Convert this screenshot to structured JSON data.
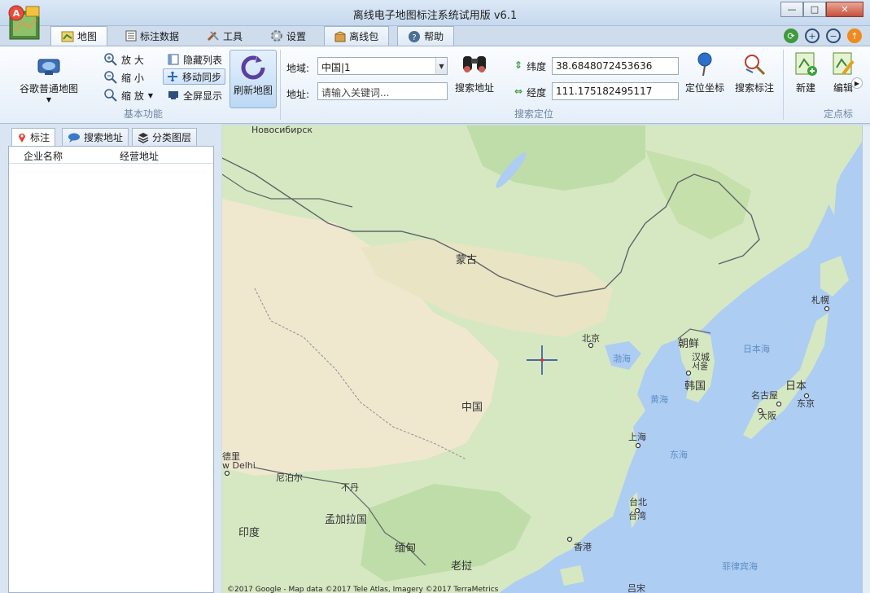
{
  "window": {
    "title": "离线电子地图标注系统试用版 v6.1",
    "logo_letter": "A",
    "controls": [
      "minimize-icon",
      "maximize-icon",
      "close-icon"
    ]
  },
  "tabs": [
    {
      "label": "地图",
      "icon": "map-icon",
      "active": true
    },
    {
      "label": "标注数据",
      "icon": "table-icon"
    },
    {
      "label": "工具",
      "icon": "tools-icon"
    },
    {
      "label": "设置",
      "icon": "gear-icon"
    },
    {
      "label": "离线包",
      "icon": "package-icon"
    },
    {
      "label": "帮助",
      "icon": "help-icon"
    }
  ],
  "right_tools": [
    "refresh-icon",
    "zoom-in-icon",
    "zoom-out-icon",
    "info-icon"
  ],
  "ribbon": {
    "basic": {
      "label": "基本功能",
      "map_type": "谷歌普通地图",
      "zoom_in": "放 大",
      "zoom_out": "缩 小",
      "zoom": "缩 放",
      "hide_list": "隐藏列表",
      "move_sync": "移动同步",
      "fullscreen": "全屏显示",
      "refresh": "刷新地图"
    },
    "search": {
      "label": "搜索定位",
      "region_label": "地域:",
      "region_value": "中国|1",
      "address_label": "地址:",
      "address_placeholder": "请输入关键词...",
      "search_address": "搜索地址",
      "lat_label": "纬度",
      "lat_value": "38.6848072453636",
      "lng_label": "经度",
      "lng_value": "111.175182495117",
      "locate": "定位坐标",
      "search_mark": "搜索标注"
    },
    "points": {
      "label": "定点标",
      "new": "新建",
      "edit": "编辑"
    }
  },
  "panel": {
    "tabs": [
      {
        "label": "标注",
        "icon": "pin-icon"
      },
      {
        "label": "搜索地址",
        "icon": "speech-bubble-icon"
      },
      {
        "label": "分类图层",
        "icon": "layers-icon"
      }
    ],
    "columns": [
      "企业名称",
      "经营地址"
    ]
  },
  "map": {
    "labels": {
      "novosibirsk": "Новосибирск",
      "mongolia": "蒙古",
      "beijing": "北京",
      "bohai": "渤海",
      "north_korea": "朝鲜",
      "seoul": "汉城",
      "seoul2": "서울",
      "korea": "韩国",
      "yellow_sea": "黄海",
      "japan_sea": "日本海",
      "japan": "日本",
      "tokyo": "东京",
      "nagoya": "名古屋",
      "osaka": "大阪",
      "sapporo": "札幌",
      "china": "中国",
      "shanghai": "上海",
      "east_sea": "东海",
      "delhi": "德里",
      "new_delhi": "w Delhi",
      "nepal": "尼泊尔",
      "bhutan": "不丹",
      "bangladesh": "孟加拉国",
      "india": "印度",
      "myanmar": "缅甸",
      "laos": "老挝",
      "taipei": "台北",
      "taiwan": "台湾",
      "hongkong": "香港",
      "philippine_sea": "菲律宾海",
      "luzon": "吕宋",
      "copyright": "©2017 Google - Map data ©2017 Tele Atlas, Imagery ©2017 TerraMetrics"
    },
    "colors": {
      "sea": "#aecdf2",
      "land": "#d7e9c3",
      "desert": "#efe7cc",
      "border": "#5f6569"
    }
  }
}
